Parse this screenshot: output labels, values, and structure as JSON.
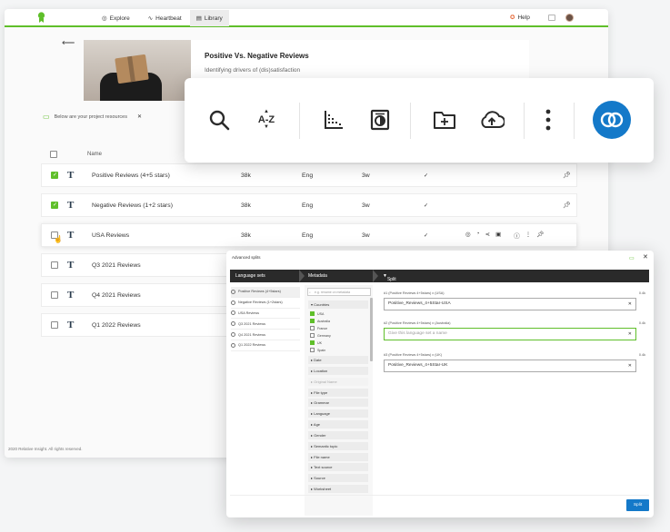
{
  "nav": {
    "explore": "Explore",
    "heartbeat": "Heartbeat",
    "library": "Library",
    "help": "Help"
  },
  "hero": {
    "title": "Positive Vs. Negative Reviews",
    "subtitle": "Identifying drivers of (dis)satisfaction"
  },
  "tip": {
    "text": "Below are your project resources"
  },
  "table": {
    "header_name": "Name",
    "rows": [
      {
        "name": "Positive Reviews (4+5 stars)",
        "count": "38k",
        "lang": "Eng",
        "age": "3w",
        "status": "✓",
        "checked": true
      },
      {
        "name": "Negative Reviews (1+2 stars)",
        "count": "38k",
        "lang": "Eng",
        "age": "3w",
        "status": "✓",
        "checked": true
      },
      {
        "name": "USA Reviews",
        "count": "38k",
        "lang": "Eng",
        "age": "3w",
        "status": "✓",
        "checked": false
      },
      {
        "name": "Q3 2021 Reviews",
        "checked": false
      },
      {
        "name": "Q4 2021 Reviews",
        "checked": false
      },
      {
        "name": "Q1 2022 Reviews",
        "checked": false
      }
    ]
  },
  "footer": {
    "copyright": "2020 Relative Insight. All rights reserved."
  },
  "toolbar": {
    "icons": [
      "search-icon",
      "sort-az-icon",
      "chart-icon",
      "compare-icon",
      "add-folder-icon",
      "upload-icon",
      "more-icon",
      "overlap-icon"
    ],
    "az_label": "A-Z"
  },
  "modal": {
    "title": "Advanced splits",
    "steps": {
      "language_sets": "Language sets",
      "metadata": "Metadata",
      "split_all": "Split all results"
    },
    "language_sets": [
      "Positive Reviews (4+5stars)",
      "Negative Reviews (1+2stars)",
      "USA Reviews",
      "Q3 2021 Reviews",
      "Q4 2021 Reviews",
      "Q1 2022 Reviews"
    ],
    "search_placeholder": "e.g. rename on metadata",
    "countries_label": "Countries",
    "countries": [
      {
        "name": "USA",
        "checked": true
      },
      {
        "name": "Australia",
        "checked": true
      },
      {
        "name": "France",
        "checked": false
      },
      {
        "name": "Germany",
        "checked": false
      },
      {
        "name": "UK",
        "checked": true
      },
      {
        "name": "Spain",
        "checked": false
      }
    ],
    "sections": [
      "Date",
      "Location",
      "Original Name",
      "File type",
      "Grammar",
      "Language",
      "Age",
      "Gender",
      "Semantic topic",
      "File name",
      "Text source",
      "Source",
      "Worksheet"
    ],
    "results": [
      {
        "label": "#1 (Positive Reviews 4+5stars) x (USA)",
        "count": "0.4k",
        "value": "Positive_Reviews_4+5Star-USA",
        "placeholder": ""
      },
      {
        "label": "#2 (Positive Reviews 4+5stars) x (Australia)",
        "count": "0.4k",
        "value": "",
        "placeholder": "Give this language set a name"
      },
      {
        "label": "#3 (Positive Reviews 4+5stars) x (UK)",
        "count": "0.4k",
        "value": "Positive_Reviews_4+5Star-UK",
        "placeholder": ""
      }
    ],
    "split_button": "Split"
  },
  "colors": {
    "accent": "#5fbf2a",
    "primary": "#1479c9",
    "dark": "#2a2a2a"
  }
}
